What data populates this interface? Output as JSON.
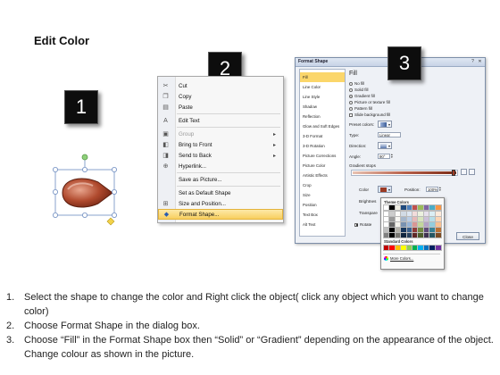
{
  "title": "Edit Color",
  "steps_badges": [
    "1",
    "2",
    "3"
  ],
  "context_menu": {
    "items": [
      {
        "label": "Cut",
        "icon": "scissors-icon",
        "glyph": "✂",
        "enabled": true,
        "submenu": false
      },
      {
        "label": "Copy",
        "icon": "copy-icon",
        "glyph": "❐",
        "enabled": true,
        "submenu": false
      },
      {
        "label": "Paste",
        "icon": "paste-icon",
        "glyph": "▤",
        "enabled": true,
        "submenu": false
      },
      {
        "label": "Edit Text",
        "icon": "edit-text-icon",
        "glyph": "A",
        "enabled": true,
        "submenu": false
      },
      {
        "label": "Group",
        "icon": "group-icon",
        "glyph": "▣",
        "enabled": false,
        "submenu": true
      },
      {
        "label": "Bring to Front",
        "icon": "bring-to-front-icon",
        "glyph": "◧",
        "enabled": true,
        "submenu": true
      },
      {
        "label": "Send to Back",
        "icon": "send-to-back-icon",
        "glyph": "◨",
        "enabled": true,
        "submenu": true
      },
      {
        "label": "Hyperlink...",
        "icon": "hyperlink-icon",
        "glyph": "⊕",
        "enabled": true,
        "submenu": false
      },
      {
        "label": "Save as Picture...",
        "icon": "",
        "glyph": "",
        "enabled": true,
        "submenu": false
      },
      {
        "label": "Set as Default Shape",
        "icon": "",
        "glyph": "",
        "enabled": true,
        "submenu": false
      },
      {
        "label": "Size and Position...",
        "icon": "size-position-icon",
        "glyph": "⊞",
        "enabled": true,
        "submenu": false
      },
      {
        "label": "Format Shape...",
        "icon": "format-shape-icon",
        "glyph": "◆",
        "enabled": true,
        "submenu": false,
        "highlighted": true
      }
    ]
  },
  "dialog": {
    "title": "Format Shape",
    "categories": [
      "Fill",
      "Line Color",
      "Line Style",
      "Shadow",
      "Reflection",
      "Glow and Soft Edges",
      "3-D Format",
      "3-D Rotation",
      "Picture Corrections",
      "Picture Color",
      "Artistic Effects",
      "Crop",
      "Size",
      "Position",
      "Text Box",
      "Alt Text"
    ],
    "selected_category": "Fill",
    "fill": {
      "heading": "Fill",
      "options": [
        {
          "label": "No fill",
          "checked": false
        },
        {
          "label": "Solid fill",
          "checked": false
        },
        {
          "label": "Gradient fill",
          "checked": true
        },
        {
          "label": "Picture or texture fill",
          "checked": false
        },
        {
          "label": "Pattern fill",
          "checked": false
        }
      ],
      "slide_background_label": "Slide background fill",
      "preset_colors_label": "Preset colors:",
      "type_label": "Type:",
      "type_value": "Linear",
      "direction_label": "Direction:",
      "angle_label": "Angle:",
      "angle_value": "90°",
      "gradient_stops_label": "Gradient stops",
      "color_label": "Color",
      "position_label": "Position:",
      "position_value": "100%",
      "brightness_label": "Brightnes",
      "transparency_label": "Transpare",
      "rotate_label": "Rotate"
    },
    "palette": {
      "theme_heading": "Theme Colors",
      "standard_heading": "Standard Colors",
      "more_colors": "More Colors...",
      "theme_top_row": [
        "#ffffff",
        "#000000",
        "#eeece1",
        "#1f497d",
        "#4f81bd",
        "#c0504d",
        "#9bbb59",
        "#8064a2",
        "#4bacc6",
        "#f79646"
      ],
      "standard_row": [
        "#c00000",
        "#ff0000",
        "#ffc000",
        "#ffff00",
        "#92d050",
        "#00b050",
        "#00b0f0",
        "#0070c0",
        "#002060",
        "#7030a0"
      ]
    },
    "close_label": "Close"
  },
  "instructions": [
    {
      "num": "1.",
      "text": "Select the shape to change the color and Right click the object( click any object which you want to change color)"
    },
    {
      "num": "2.",
      "text": "Choose Format Shape in the dialog box."
    },
    {
      "num": "3.",
      "text": "Choose “Fill” in the Format Shape box then “Solid” or “Gradient” depending on the appearance of the object. Change colour as shown in the picture."
    }
  ],
  "colors": {
    "shape_fill": "#b04a2e",
    "menu_highlight": "#f8cf5f",
    "dialog_selected": "#fbd66a",
    "handle": "#7fb05a"
  }
}
